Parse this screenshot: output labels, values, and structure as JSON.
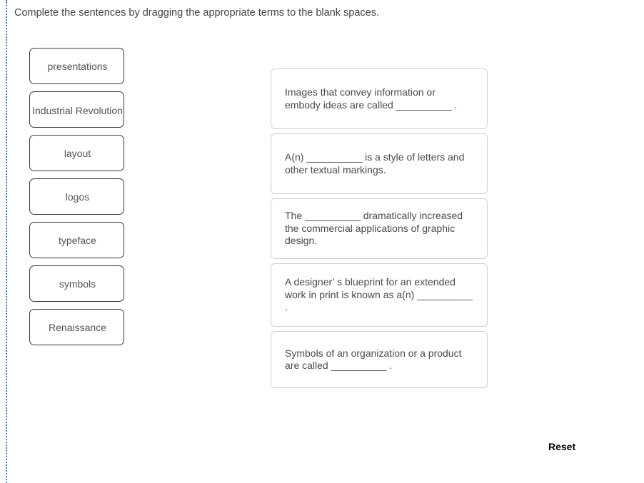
{
  "instruction": "Complete the sentences by dragging the appropriate terms to the blank spaces.",
  "terms": [
    {
      "label": "presentations",
      "lines": 1
    },
    {
      "label": "Industrial Revolution",
      "lines": 2
    },
    {
      "label": "layout",
      "lines": 1
    },
    {
      "label": "logos",
      "lines": 1
    },
    {
      "label": "typeface",
      "lines": 1
    },
    {
      "label": "symbols",
      "lines": 1
    },
    {
      "label": "Renaissance",
      "lines": 1
    }
  ],
  "sentences": [
    {
      "text": "Images that convey information or embody ideas are called __________ ."
    },
    {
      "text": "A(n)  __________  is a style of letters and other textual markings."
    },
    {
      "text": "The  __________  dramatically increased the commercial applications of graphic design."
    },
    {
      "text": "A designer’ s blueprint for an extended work in print is known as a(n)  __________ ."
    },
    {
      "text": "Symbols of an organization or a product are called  __________ ."
    }
  ],
  "reset_label": "Reset",
  "colors": {
    "accent_border": "#3f76b5",
    "term_border": "#3a3a3a",
    "panel_border": "#cfcfcf",
    "text": "#4a4a4a"
  }
}
